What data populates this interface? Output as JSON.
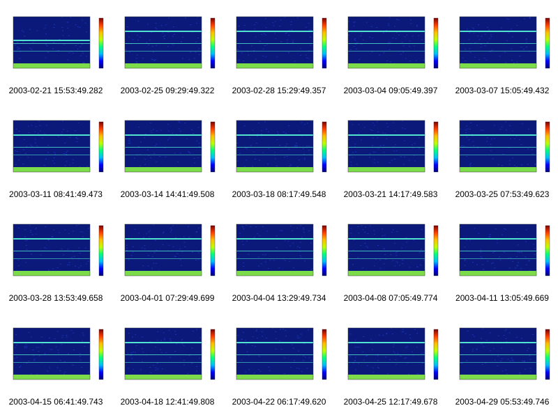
{
  "colors": {
    "background": "#ffffff",
    "spectrogram_dark": "#0b1a7a",
    "spectrogram_mid": "#1a3ac8",
    "band_line": "#4fe3d0",
    "low_freq_band": "#7ddc4a",
    "colorbar_stops": [
      "#00007f",
      "#0000ff",
      "#00bfff",
      "#00ff7f",
      "#bfff00",
      "#ffbf00",
      "#ff3f00",
      "#7f0000"
    ]
  },
  "thumbnail_icon": "spectrogram-plot",
  "panels": [
    {
      "caption": "2003-02-21 15:53:49.282",
      "band_row": 2
    },
    {
      "caption": "2003-02-25 09:29:49.322",
      "band_row": 1
    },
    {
      "caption": "2003-02-28 15:29:49.357",
      "band_row": 1
    },
    {
      "caption": "2003-03-04 09:05:49.397",
      "band_row": 1
    },
    {
      "caption": "2003-03-07 15:05:49.432",
      "band_row": 1
    },
    {
      "caption": "2003-03-11 08:41:49.473",
      "band_row": 1
    },
    {
      "caption": "2003-03-14 14:41:49.508",
      "band_row": 1
    },
    {
      "caption": "2003-03-18 08:17:49.548",
      "band_row": 1
    },
    {
      "caption": "2003-03-21 14:17:49.583",
      "band_row": 1
    },
    {
      "caption": "2003-03-25 07:53:49.623",
      "band_row": 1
    },
    {
      "caption": "2003-03-28 13:53:49.658",
      "band_row": 1
    },
    {
      "caption": "2003-04-01 07:29:49.699",
      "band_row": 1
    },
    {
      "caption": "2003-04-04 13:29:49.734",
      "band_row": 1
    },
    {
      "caption": "2003-04-08 07:05:49.774",
      "band_row": 1
    },
    {
      "caption": "2003-04-11 13:05:49.669",
      "band_row": 1
    },
    {
      "caption": "2003-04-15 06:41:49.743",
      "band_row": 1
    },
    {
      "caption": "2003-04-18 12:41:49.808",
      "band_row": 1
    },
    {
      "caption": "2003-04-22 06:17:49.620",
      "band_row": 1
    },
    {
      "caption": "2003-04-25 12:17:49.678",
      "band_row": 1
    },
    {
      "caption": "2003-04-29 05:53:49.746",
      "band_row": 1
    }
  ]
}
